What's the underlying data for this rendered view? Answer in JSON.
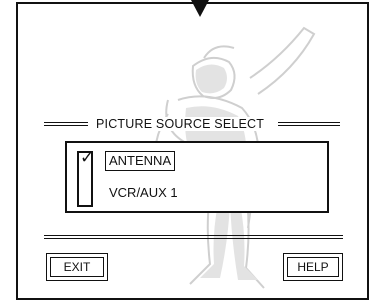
{
  "menu": {
    "title": "PICTURE SOURCE SELECT",
    "options": [
      {
        "label": "ANTENNA",
        "selected": true
      },
      {
        "label": "VCR/AUX 1",
        "selected": false
      }
    ],
    "check_glyph": "✓"
  },
  "buttons": {
    "exit_label": "EXIT",
    "help_label": "HELP"
  },
  "icons": {
    "pointer": "down-arrow-icon",
    "background": "baseball-player-watermark"
  }
}
